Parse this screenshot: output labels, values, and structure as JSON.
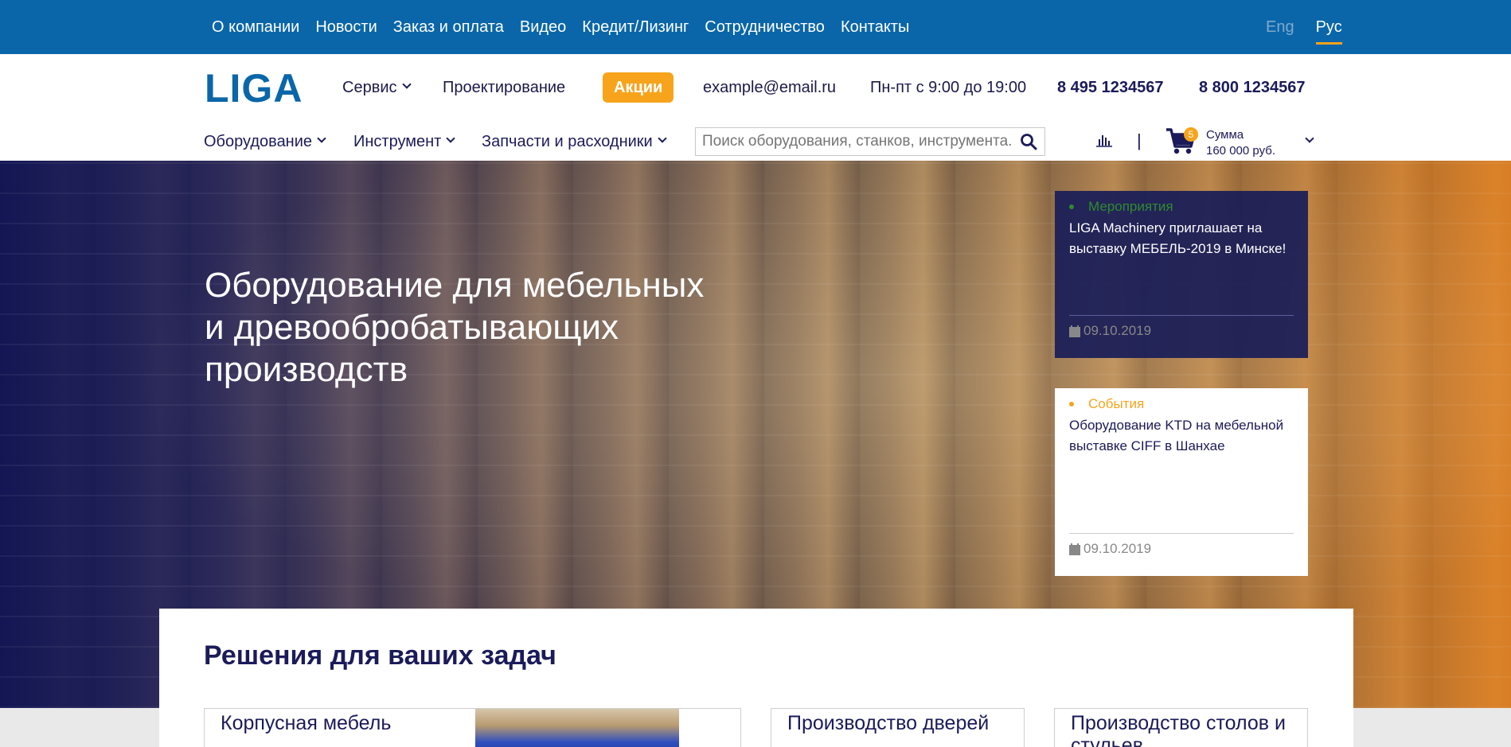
{
  "topnav": {
    "items": [
      "О компании",
      "Новости",
      "Заказ и оплата",
      "Видео",
      "Кредит/Лизинг",
      "Сотрудничество",
      "Контакты"
    ],
    "langs": [
      {
        "label": "Eng",
        "active": false
      },
      {
        "label": "Рус",
        "active": true
      }
    ]
  },
  "header": {
    "logo": "LIGA",
    "service": "Сервис",
    "design": "Проектирование",
    "promo": "Акции",
    "email": "example@email.ru",
    "hours": "Пн-пт с 9:00 до 19:00",
    "phone1": "8 495 1234567",
    "phone2": "8 800 1234567"
  },
  "catnav": {
    "equipment": "Оборудование",
    "tools": "Инструмент",
    "parts": "Запчасти и расходники"
  },
  "search": {
    "placeholder": "Поиск оборудования, станков, инструмента..."
  },
  "cart": {
    "count": "5",
    "sum_label": "Сумма",
    "sum_value": "160 000 руб."
  },
  "hero": {
    "title_line1": "Оборудование для мебельных",
    "title_line2": "и древообробатывающих",
    "title_line3": "производств"
  },
  "news": [
    {
      "category": "Мероприятия",
      "category_color": "#2e8b2e",
      "title": "LIGA Machinery приглашает на выставку МЕБЕЛЬ-2019 в Минске!",
      "date": "09.10.2019"
    },
    {
      "category": "События",
      "category_color": "#f7a31b",
      "title": "Оборудование KTD на мебельной выставке CIFF в Шанхае",
      "date": "09.10.2019"
    }
  ],
  "solutions": {
    "title": "Решения для ваших задач",
    "cards": [
      "Корпусная мебель",
      "Производство дверей",
      "Производство столов и стульев"
    ]
  },
  "colors": {
    "brand_blue": "#0a66a9",
    "accent_orange": "#f7a31b",
    "navy": "#1b1b5a"
  }
}
